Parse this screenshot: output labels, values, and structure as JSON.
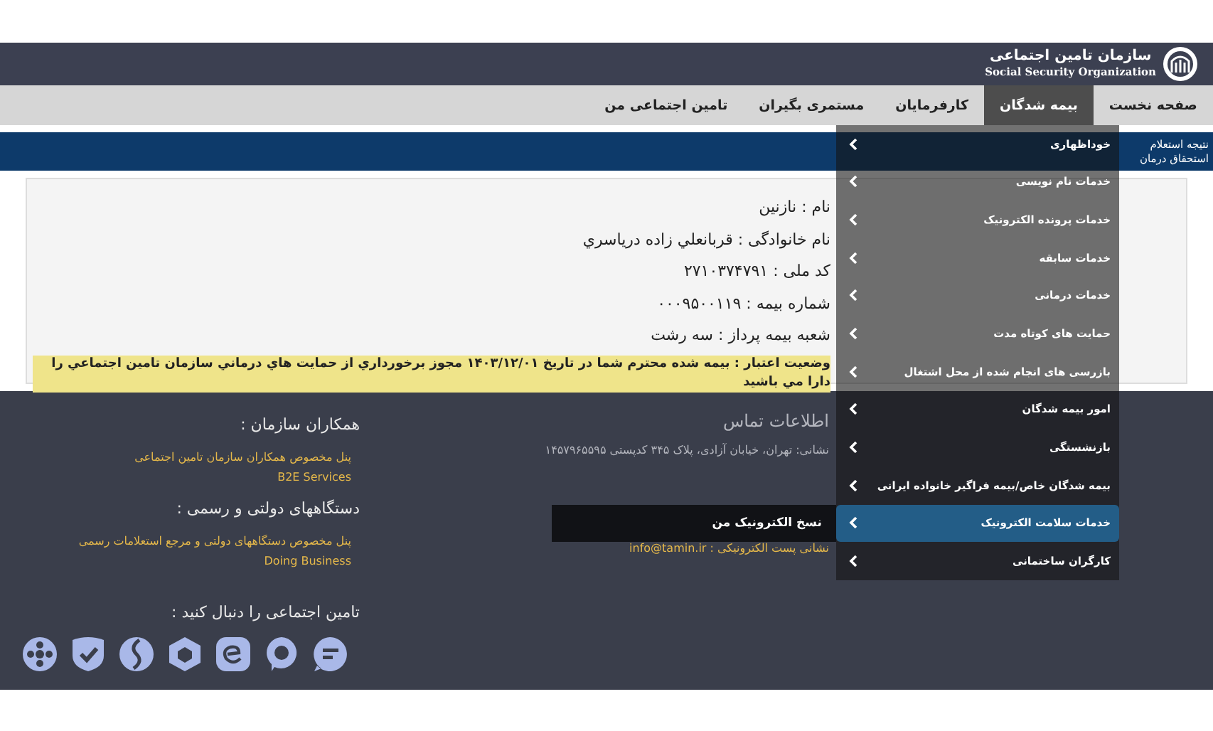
{
  "header": {
    "logo_title": "سازمان تامین اجتماعی",
    "logo_subtitle": "Social Security Organization"
  },
  "nav": [
    {
      "label": "صفحه نخست",
      "selected": false
    },
    {
      "label": "بیمه شدگان",
      "selected": true
    },
    {
      "label": "کارفرمایان",
      "selected": false
    },
    {
      "label": "مستمری بگیران",
      "selected": false
    },
    {
      "label": "تامین اجتماعی من",
      "selected": false
    }
  ],
  "breadcrumb": "نتیجه استعلام استحقاق درمان",
  "details": [
    "نام : نازنين",
    "نام خانوادگی : قربانعلي زاده درياسري",
    "کد ملی : ۲۷۱۰۳۷۴۷۹۱",
    "شماره بیمه : ۰۰۰۹۵۰۰۱۱۹",
    "شعبه بیمه پرداز : سه رشت"
  ],
  "status": "وضعيت اعتبار : بيمه شده محترم شما در تاريخ ۱۴۰۳/۱۲/۰۱ مجوز برخورداري از حمايت هاي درماني سازمان تامين اجتماعي را دارا مي باشيد",
  "menu": [
    {
      "label": "خوداظهاری",
      "selected": false
    },
    {
      "label": "خدمات نام نویسی",
      "selected": false
    },
    {
      "label": "خدمات پرونده الکترونیک",
      "selected": false
    },
    {
      "label": "خدمات سابقه",
      "selected": false
    },
    {
      "label": "خدمات درمانی",
      "selected": false
    },
    {
      "label": "حمایت های کوتاه مدت",
      "selected": false
    },
    {
      "label": "بازرسی های انجام شده از محل اشتغال",
      "selected": false
    },
    {
      "label": "امور بیمه شدگان",
      "selected": false
    },
    {
      "label": "بازنشستگی",
      "selected": false
    },
    {
      "label": "بیمه شدگان خاص/بیمه فراگیر خانواده ایرانی",
      "selected": false
    },
    {
      "label": "خدمات سلامت الکترونیک",
      "selected": true,
      "submenu": [
        "نسخ الکترونیک من"
      ]
    },
    {
      "label": "کارگران ساختمانی",
      "selected": false
    }
  ],
  "footer": {
    "contact": {
      "title": "اطلاعات تماس",
      "address": "نشانی: تهران، خیابان آزادی، پلاک ۳۴۵ کدپستی ۱۴۵۷۹۶۵۵۹۵",
      "email_label": "نشانی پست الکترونیکی :",
      "email": "info@tamin.ir"
    },
    "sections": [
      {
        "heading": "همکاران سازمان :",
        "links": [
          "پنل مخصوص همکاران سازمان تامین اجتماعی",
          "B2E Services"
        ]
      },
      {
        "heading": "دستگاههای دولتی و رسمی :",
        "links": [
          "پنل مخصوص دستگاههای دولتی و مرجع استعلامات رسمی",
          "Doing Business"
        ]
      }
    ],
    "follow": "تامین اجتماعی را دنبال کنید :"
  }
}
